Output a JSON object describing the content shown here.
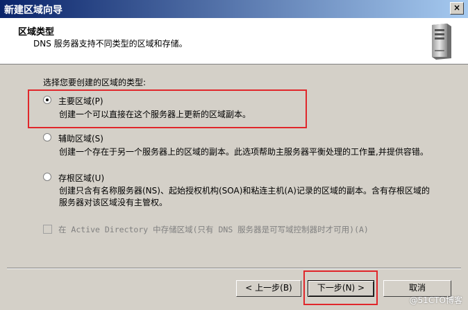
{
  "window": {
    "title": "新建区域向导",
    "close_glyph": "×"
  },
  "header": {
    "title": "区域类型",
    "subtitle": "DNS 服务器支持不同类型的区域和存储。",
    "icon": "server-icon"
  },
  "prompt": "选择您要创建的区域的类型:",
  "options": [
    {
      "label": "主要区域(P)",
      "selected": true,
      "description": "创建一个可以直接在这个服务器上更新的区域副本。"
    },
    {
      "label": "辅助区域(S)",
      "selected": false,
      "description": "创建一个存在于另一个服务器上的区域的副本。此选项帮助主服务器平衡处理的工作量,并提供容错。"
    },
    {
      "label": "存根区域(U)",
      "selected": false,
      "description": "创建只含有名称服务器(NS)、起始授权机构(SOA)和粘连主机(A)记录的区域的副本。含有存根区域的服务器对该区域没有主管权。"
    }
  ],
  "ad_checkbox": {
    "label": "在 Active Directory 中存储区域(只有 DNS 服务器是可写域控制器时才可用)(A)",
    "checked": false,
    "enabled": false
  },
  "buttons": {
    "back": "< 上一步(B)",
    "next": "下一步(N) >",
    "cancel": "取消"
  },
  "watermark": "@51CTO博客",
  "colors": {
    "highlight": "#e0262a",
    "title_bar": "#0a246a",
    "dialog_bg": "#d4d0c8"
  }
}
